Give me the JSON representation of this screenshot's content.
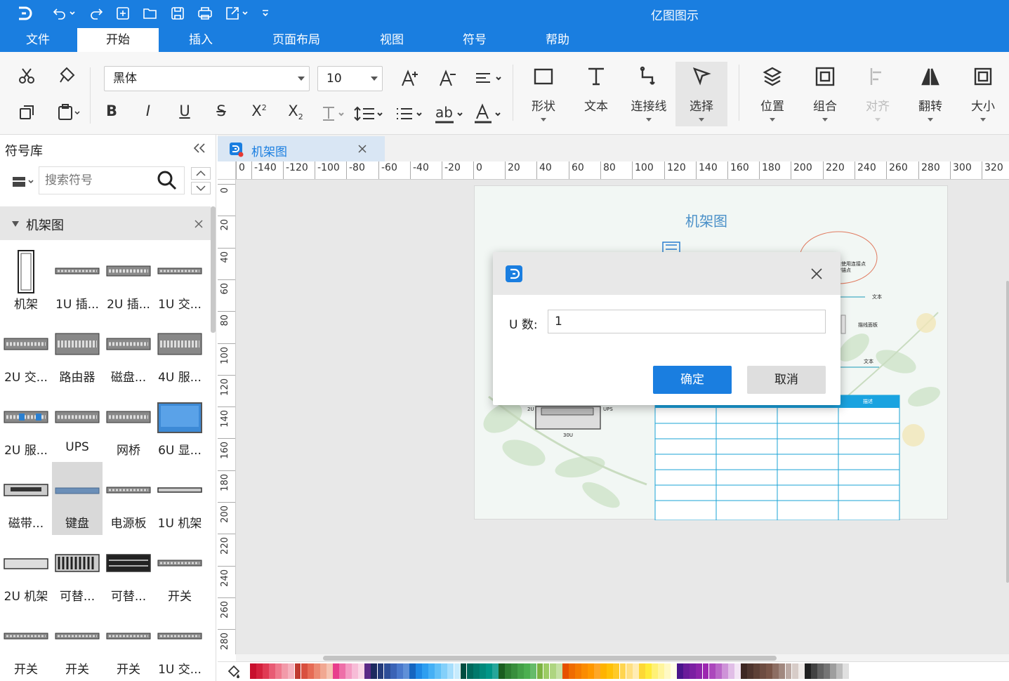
{
  "app": {
    "title": "亿图图示"
  },
  "menu": {
    "items": [
      {
        "label": "文件",
        "active": false
      },
      {
        "label": "开始",
        "active": true
      },
      {
        "label": "插入",
        "active": false
      },
      {
        "label": "页面布局",
        "active": false
      },
      {
        "label": "视图",
        "active": false
      },
      {
        "label": "符号",
        "active": false
      },
      {
        "label": "帮助",
        "active": false
      }
    ]
  },
  "ribbon": {
    "font_name": "黑体",
    "font_size": "10",
    "tools": [
      {
        "label": "形状",
        "icon": "rectangle-icon"
      },
      {
        "label": "文本",
        "icon": "text-T-icon"
      },
      {
        "label": "连接线",
        "icon": "connector-icon"
      },
      {
        "label": "选择",
        "icon": "pointer-icon",
        "active": true
      },
      {
        "label": "位置",
        "icon": "layers-icon"
      },
      {
        "label": "组合",
        "icon": "group-icon"
      },
      {
        "label": "对齐",
        "icon": "align-icon",
        "disabled": true
      },
      {
        "label": "翻转",
        "icon": "flip-icon"
      },
      {
        "label": "大小",
        "icon": "size-icon"
      }
    ]
  },
  "library": {
    "title": "符号库",
    "search_placeholder": "搜索符号",
    "category": "机架图",
    "symbols": [
      "机架",
      "1U 插...",
      "2U 插...",
      "1U 交...",
      "2U 交...",
      "路由器",
      "磁盘...",
      "4U 服...",
      "2U 服...",
      "UPS",
      "网桥",
      "6U 显...",
      "磁带...",
      "键盘",
      "电源板",
      "1U 机架",
      "2U 机架",
      "可替...",
      "可替...",
      "开关",
      "开关",
      "开关",
      "开关",
      "1U 交..."
    ],
    "highlighted": "键盘"
  },
  "document": {
    "tab_label": "机架图",
    "page_title": "机架图"
  },
  "rulers": {
    "h": [
      "0",
      "-140",
      "-120",
      "-100",
      "-80",
      "-60",
      "-40",
      "-20",
      "0",
      "20",
      "40",
      "60",
      "80",
      "100",
      "120",
      "140",
      "160",
      "180",
      "200",
      "220",
      "240",
      "260",
      "280",
      "300",
      "320"
    ],
    "v": [
      "0",
      "20",
      "40",
      "60",
      "80",
      "100",
      "120",
      "140",
      "160",
      "180",
      "200",
      "220",
      "240",
      "260",
      "280"
    ]
  },
  "diagram_text": {
    "bubble": "后使用连接点\n增锚点",
    "label1": "文本",
    "label2": "描线面板",
    "label3": "文本",
    "table_header": "描述",
    "rack_2u": "2U",
    "rack_ups": "UPS",
    "rack_30u": "30U"
  },
  "dialog": {
    "field_label": "U 数:",
    "field_value": "1",
    "ok_label": "确定",
    "cancel_label": "取消"
  },
  "colors": {
    "accent": "#1a7ee0",
    "palette": [
      "#c8102e",
      "#d4213d",
      "#e03a54",
      "#e85b74",
      "#ef7a8e",
      "#f29aa9",
      "#f5b2be",
      "#c03a30",
      "#d9503f",
      "#e66b55",
      "#ec8a73",
      "#f1a892",
      "#f5c4b2",
      "#e83e8c",
      "#ee6fa8",
      "#f49cc4",
      "#f7bcd7",
      "#f9d7e6",
      "#5b2a86",
      "#1b2a5e",
      "#243b7a",
      "#2d4e98",
      "#3a63b6",
      "#4a79cc",
      "#5f90d8",
      "#1565c0",
      "#1e88e5",
      "#2d9ef0",
      "#45b0f5",
      "#63c1f7",
      "#84d0fa",
      "#a6defc",
      "#c6ebfd",
      "#004d40",
      "#00695c",
      "#00796b",
      "#00897b",
      "#009688",
      "#26a69a",
      "#1b5e20",
      "#2e7d32",
      "#388e3c",
      "#43a047",
      "#4caf50",
      "#66bb6a",
      "#7cb342",
      "#9ccc65",
      "#aed581",
      "#c5e1a5",
      "#e65100",
      "#ef6c00",
      "#f57c00",
      "#fb8c00",
      "#ff9800",
      "#ffa726",
      "#ffb300",
      "#ffc107",
      "#ffca28",
      "#ffd54f",
      "#ffe082",
      "#ffecb3",
      "#fdd835",
      "#ffeb3b",
      "#fff176",
      "#fff59d",
      "#fff9c4",
      "#fffde7",
      "#4a148c",
      "#6a1b9a",
      "#7b1fa2",
      "#8e24aa",
      "#9c27b0",
      "#ab47bc",
      "#ba68c8",
      "#ce93d8",
      "#e1bee7",
      "#f3e5f5",
      "#3e2723",
      "#4e342e",
      "#5d4037",
      "#6d4c41",
      "#795548",
      "#8d6e63",
      "#a1887f",
      "#bcaaa4",
      "#d7ccc8",
      "#efebe9",
      "#212121",
      "#424242",
      "#616161",
      "#757575",
      "#9e9e9e",
      "#bdbdbd",
      "#e0e0e0"
    ]
  }
}
